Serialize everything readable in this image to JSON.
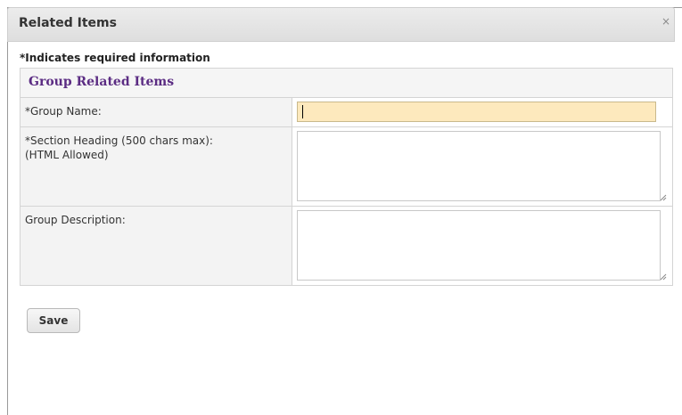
{
  "dialog": {
    "title": "Related Items",
    "close_glyph": "×",
    "close_icon": "close-icon"
  },
  "form": {
    "required_note": "*Indicates required information",
    "section_title": "Group Related Items",
    "fields": {
      "group_name": {
        "label": "*Group Name:",
        "value": "",
        "focused": true
      },
      "section_heading": {
        "label_line1": "*Section Heading (500 chars max):",
        "label_line2": "(HTML Allowed)",
        "value": ""
      },
      "group_description": {
        "label": "Group Description:",
        "value": ""
      }
    }
  },
  "actions": {
    "save_label": "Save"
  },
  "colors": {
    "section_title": "#5b2c83",
    "focused_input_bg": "#fde9bd"
  }
}
